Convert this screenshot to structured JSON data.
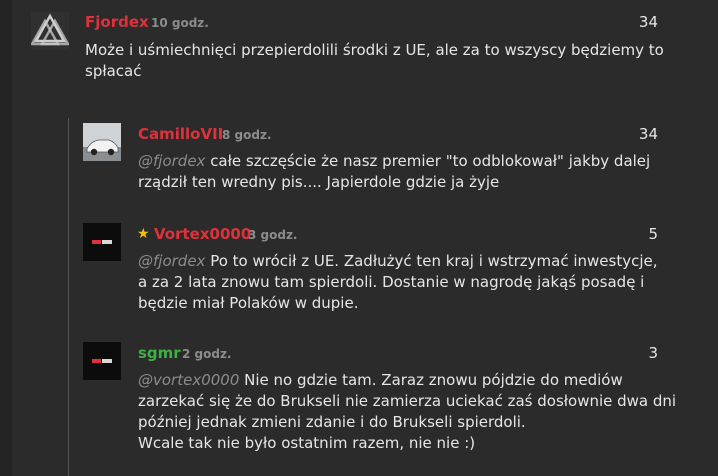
{
  "comments": [
    {
      "author": "Fjordex",
      "time": "10 godz.",
      "score": "34",
      "author_color": "#e0313b",
      "avatar_icon": "valknut-logo-icon",
      "text": "Może i uśmiechnięci przepierdolili środki z UE, ale za to wszyscy będziemy to spłacać"
    },
    {
      "author": "CamilloVII",
      "time": "8 godz.",
      "score": "34",
      "author_color": "#e0313b",
      "avatar_icon": "car-photo-icon",
      "mention": "@fjordex",
      "text": " całe szczęście że nasz premier \"to odblokował\" jakby dalej rządził ten wredny pis.... Japierdole gdzie ja żyje"
    },
    {
      "author": "Vortex0000",
      "time": "3 godz.",
      "score": "5",
      "author_color": "#e0313b",
      "avatar_icon": "dark-logo-icon",
      "badge_icon": "star-icon",
      "mention": "@fjordex",
      "text": " Po to wrócił z UE. Zadłużyć ten kraj i wstrzymać inwestycje, a za 2 lata znowu tam spierdoli. Dostanie w nagrodę jakąś posadę i będzie miał Polaków w dupie."
    },
    {
      "author": "sgmr",
      "time": "2 godz.",
      "score": "3",
      "author_color": "#3cb043",
      "avatar_icon": "dark-logo-icon",
      "mention": "@vortex0000",
      "text": " Nie no gdzie tam. Zaraz znowu pójdzie do mediów zarzekać się że do Brukseli nie zamierza uciekać zaś dosłownie dwa dni później jednak zmieni zdanie i do Brukseli spierdoli.",
      "text2": "Wcale tak nie było ostatnim razem, nie nie :)"
    }
  ]
}
